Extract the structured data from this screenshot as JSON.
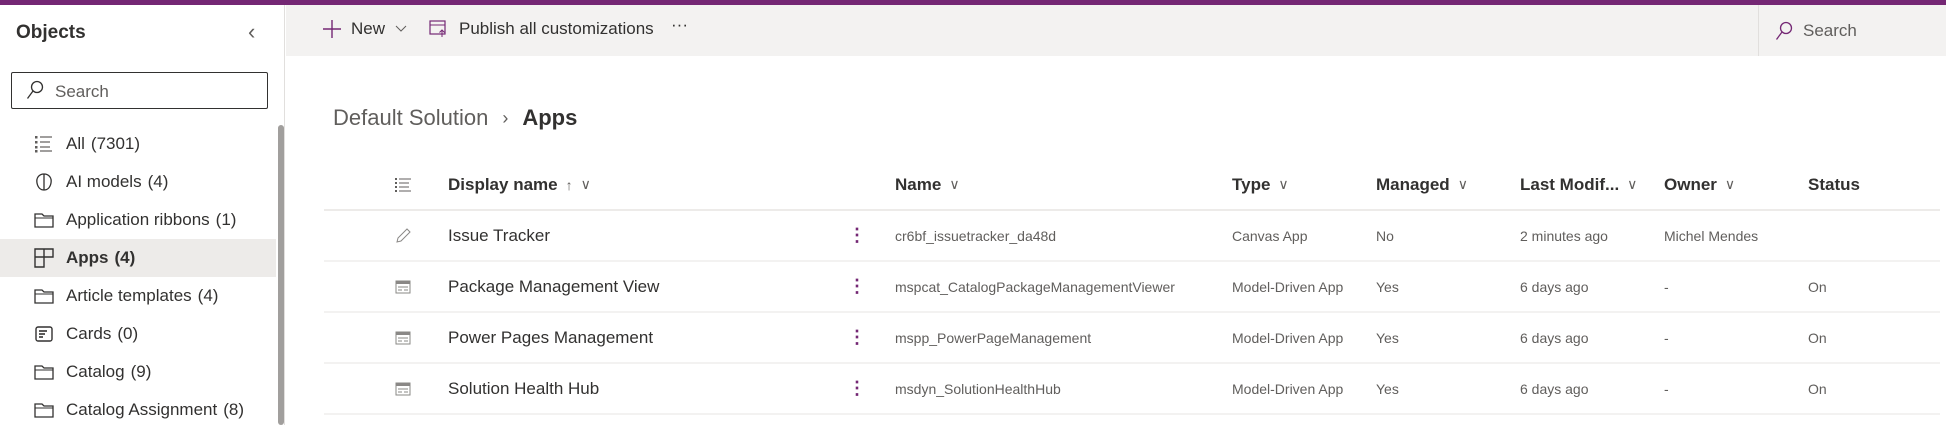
{
  "sidebar": {
    "title": "Objects",
    "search_placeholder": "Search",
    "items": [
      {
        "label": "All",
        "count": "(7301)",
        "icon": "list-icon"
      },
      {
        "label": "AI models",
        "count": "(4)",
        "icon": "brain-icon"
      },
      {
        "label": "Application ribbons",
        "count": "(1)",
        "icon": "folder-icon"
      },
      {
        "label": "Apps",
        "count": "(4)",
        "icon": "apps-icon",
        "selected": true
      },
      {
        "label": "Article templates",
        "count": "(4)",
        "icon": "folder-icon"
      },
      {
        "label": "Cards",
        "count": "(0)",
        "icon": "card-icon"
      },
      {
        "label": "Catalog",
        "count": "(9)",
        "icon": "folder-icon"
      },
      {
        "label": "Catalog Assignment",
        "count": "(8)",
        "icon": "folder-icon"
      }
    ]
  },
  "toolbar": {
    "new_label": "New",
    "publish_label": "Publish all customizations",
    "more": "···",
    "search_label": "Search"
  },
  "breadcrumb": {
    "parent": "Default Solution",
    "current": "Apps"
  },
  "table": {
    "headers": {
      "display_name": "Display name",
      "sort": "↑",
      "name": "Name",
      "type": "Type",
      "managed": "Managed",
      "last_modified": "Last Modif...",
      "owner": "Owner",
      "status": "Status"
    },
    "rows": [
      {
        "icon": "pencil-icon",
        "display_name": "Issue Tracker",
        "name": "cr6bf_issuetracker_da48d",
        "type": "Canvas App",
        "managed": "No",
        "last_modified": "2 minutes ago",
        "owner": "Michel Mendes",
        "status": ""
      },
      {
        "icon": "form-icon",
        "display_name": "Package Management View",
        "name": "mspcat_CatalogPackageManagementViewer",
        "type": "Model-Driven App",
        "managed": "Yes",
        "last_modified": "6 days ago",
        "owner": "-",
        "status": "On"
      },
      {
        "icon": "form-icon",
        "display_name": "Power Pages Management",
        "name": "mspp_PowerPageManagement",
        "type": "Model-Driven App",
        "managed": "Yes",
        "last_modified": "6 days ago",
        "owner": "-",
        "status": "On"
      },
      {
        "icon": "form-icon",
        "display_name": "Solution Health Hub",
        "name": "msdyn_SolutionHealthHub",
        "type": "Model-Driven App",
        "managed": "Yes",
        "last_modified": "6 days ago",
        "owner": "-",
        "status": "On"
      }
    ]
  },
  "colors": {
    "brand": "#742774",
    "selected": "#edebe9",
    "toolbar": "#f3f2f1"
  }
}
